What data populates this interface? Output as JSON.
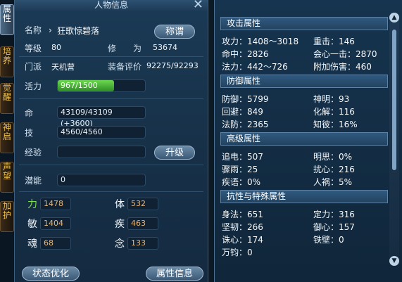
{
  "vertical_tabs": [
    {
      "label": "属性"
    },
    {
      "label": "培养"
    },
    {
      "label": "觉醒"
    },
    {
      "label": "神启"
    },
    {
      "label": "声望"
    },
    {
      "label": "加护"
    }
  ],
  "character": {
    "window_title": "人物信息",
    "name_label": "名称",
    "name_value": "狂歌惊碧落",
    "title_button": "称谓",
    "level_label": "等级",
    "level_value": "80",
    "cultivation_label": "修　　为",
    "cultivation_value": "53674",
    "sect_label": "门派",
    "sect_value": "天机营",
    "equip_label": "装备评价",
    "equip_value": "92275/92293",
    "vitality_label": "活力",
    "vitality_value": "967/1500",
    "vitality_fraction": 0.645,
    "hp_label": "命",
    "hp_value": "43109/43109 (+3600)",
    "mp_label": "技",
    "mp_value": "4560/4560",
    "exp_label": "经验",
    "exp_value": "",
    "upgrade_button": "升级",
    "potential_label": "潜能",
    "potential_value": "0",
    "attributes": [
      {
        "label": "力",
        "value": "1478",
        "accent": "#7de046"
      },
      {
        "label": "体",
        "value": "532",
        "accent": "#ffffff"
      },
      {
        "label": "敏",
        "value": "1404",
        "accent": "#ffffff"
      },
      {
        "label": "疾",
        "value": "463",
        "accent": "#ffffff"
      },
      {
        "label": "魂",
        "value": "68",
        "accent": "#ffffff"
      },
      {
        "label": "念",
        "value": "133",
        "accent": "#ffffff"
      }
    ],
    "status_button": "状态优化",
    "attr_info_button": "属性信息"
  },
  "stats": {
    "sections": [
      {
        "title": "攻击属性",
        "rows": [
          {
            "left": "攻力：1408～3018",
            "right": "重击：146"
          },
          {
            "left": "命中：2826",
            "right": "会心一击：2870"
          },
          {
            "left": "法力：442～726",
            "right": "附加伤害：460"
          }
        ]
      },
      {
        "title": "防御属性",
        "rows": [
          {
            "left": "防御：5799",
            "right": "神明：93"
          },
          {
            "left": "回避：849",
            "right": "化解：116"
          },
          {
            "left": "法防：2365",
            "right": "知彼：16%"
          }
        ]
      },
      {
        "title": "高级属性",
        "rows": [
          {
            "left": "追电：507",
            "right": "明思：0%"
          },
          {
            "left": "骤雨：25",
            "right": "扰心：216"
          },
          {
            "left": "疾语：0%",
            "right": "人祸：5%"
          }
        ]
      },
      {
        "title": "抗性与特殊属性",
        "rows": [
          {
            "left": "身法：651",
            "right": "定力：316"
          },
          {
            "left": "坚韧：266",
            "right": "御心：157"
          },
          {
            "left": "诛心：174",
            "right": "铁壁：0"
          },
          {
            "left": "万钧：0",
            "right": ""
          }
        ]
      }
    ]
  }
}
